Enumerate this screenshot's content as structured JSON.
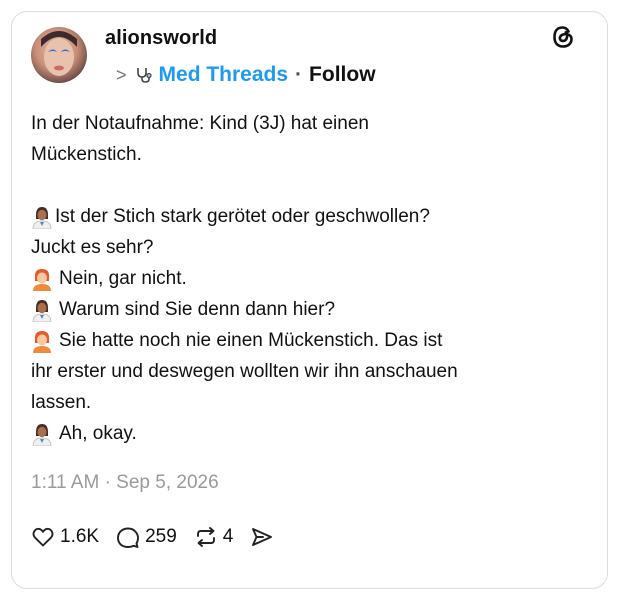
{
  "post": {
    "username": "alionsworld",
    "community": "Med Threads",
    "separator": "·",
    "follow_label": "Follow",
    "lines": [
      "In der Notaufnahme: Kind (3J) hat einen",
      "Mückenstich.",
      "",
      "Ist der Stich stark gerötet oder geschwollen?",
      "Juckt es sehr?",
      "Nein, gar nicht.",
      "Warum sind Sie denn dann hier?",
      "Sie hatte noch nie einen Mückenstich. Das ist",
      "ihr erster und deswegen wollten wir ihn anschauen",
      "lassen.",
      "Ah, okay."
    ],
    "timestamp": "1:11 AM · Sep 5, 2026",
    "stats": {
      "likes": "1.6K",
      "replies": "259",
      "reposts": "4"
    }
  },
  "icons": {
    "logo": "threads-logo-icon",
    "chevron": "chevron-right-icon",
    "community": "stethoscope-icon",
    "speaker_doctor": "doctor-emoji-icon",
    "speaker_parent": "person-red-hair-emoji-icon",
    "like": "heart-icon",
    "reply": "comment-icon",
    "repost": "repost-icon",
    "share": "share-icon"
  },
  "colors": {
    "accent": "#1d9bf0",
    "muted": "#9a9a9a",
    "border": "#dcdcdc"
  }
}
